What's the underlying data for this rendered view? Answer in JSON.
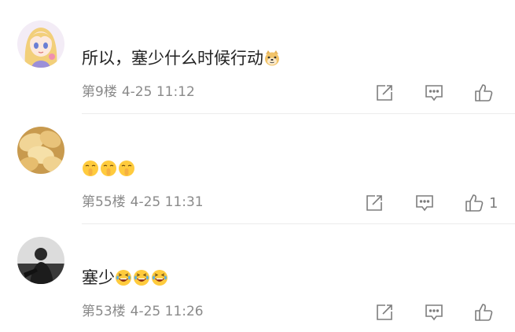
{
  "comments": [
    {
      "avatar": "anime-girl-avatar",
      "text": "所以，塞少什么时候行动",
      "trailing_emoji": "doge-emoji",
      "floor": "第9楼",
      "time": "4-25 11:12",
      "like_count": ""
    },
    {
      "avatar": "potato-chips-avatar",
      "text": "",
      "emojis": [
        "shush-emoji",
        "shush-emoji",
        "shush-emoji"
      ],
      "floor": "第55楼",
      "time": "4-25 11:31",
      "like_count": "1"
    },
    {
      "avatar": "person-photo-avatar",
      "text": "塞少",
      "emojis": [
        "laughing-emoji",
        "laughing-emoji",
        "laughing-emoji"
      ],
      "floor": "第53楼",
      "time": "4-25 11:26",
      "like_count": ""
    }
  ],
  "icons": {
    "share": "share-icon",
    "reply": "comment-icon",
    "like": "thumbs-up-icon"
  },
  "colors": {
    "text": "#222222",
    "meta": "#8a8a8a",
    "icon": "#7d7d7d",
    "divider": "#ececec"
  }
}
